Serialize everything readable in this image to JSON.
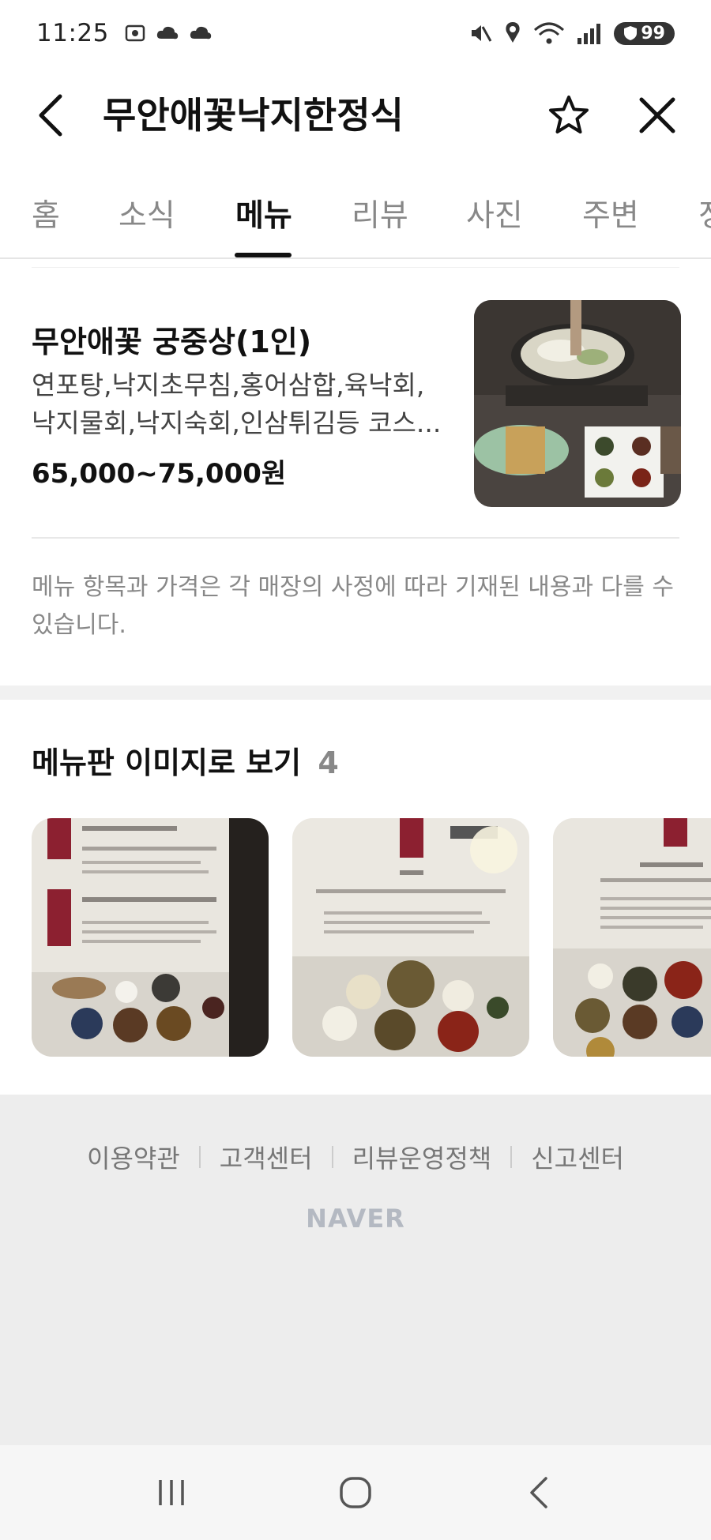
{
  "status_bar": {
    "time": "11:25",
    "battery": "99"
  },
  "header": {
    "title": "무안애꽃낙지한정식"
  },
  "tabs": [
    {
      "label": "홈"
    },
    {
      "label": "소식"
    },
    {
      "label": "메뉴"
    },
    {
      "label": "리뷰"
    },
    {
      "label": "사진"
    },
    {
      "label": "주변"
    },
    {
      "label": "정"
    }
  ],
  "active_tab": "메뉴",
  "menu": {
    "name": "무안애꽃 궁중상(1인)",
    "description": "연포탕,낙지초무침,홍어삼합,육낙회,낙지물회,낙지숙회,인삼튀김등 코스...",
    "price": "65,000~75,000원"
  },
  "notice": "메뉴 항목과 가격은 각 매장의 사정에 따라 기재된 내용과 다를 수 있습니다.",
  "menu_board": {
    "title": "메뉴판 이미지로 보기",
    "count": "4"
  },
  "footer": {
    "links": [
      "이용약관",
      "고객센터",
      "리뷰운영정책",
      "신고센터"
    ],
    "logo": "NAVER"
  },
  "colors": {
    "text_primary": "#111111",
    "text_secondary": "#888888",
    "footer_bg": "#ededed",
    "logo_gray": "#b4b9c2"
  }
}
